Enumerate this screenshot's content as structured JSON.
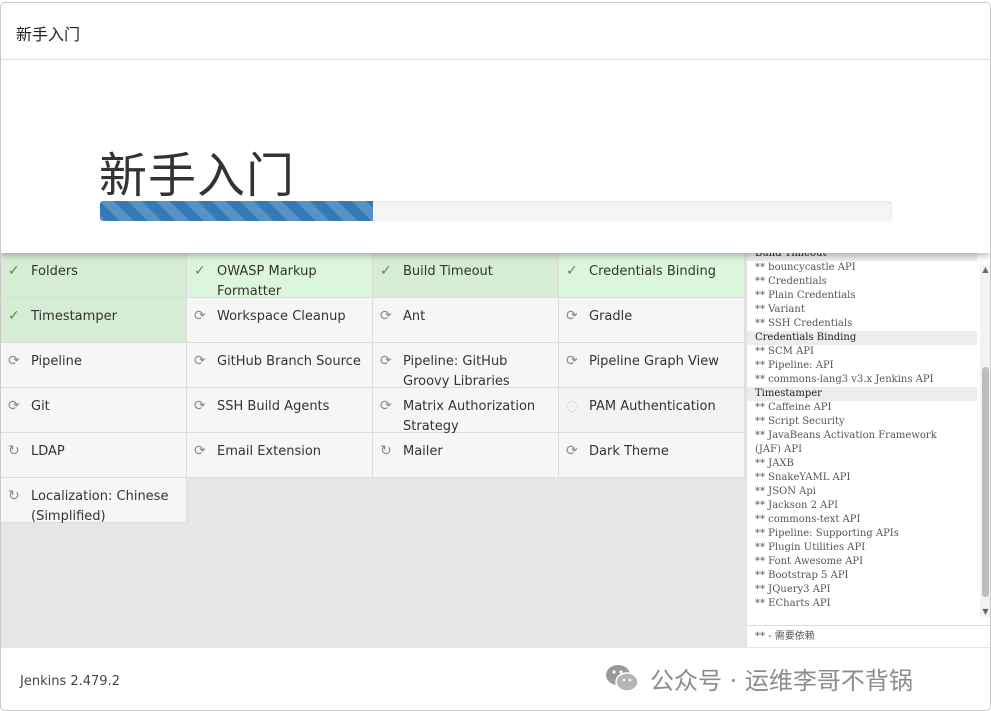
{
  "window": {
    "title": "新手入门"
  },
  "header": {
    "heading": "新手入门",
    "progress": 0.345
  },
  "plugins": [
    {
      "name": "Folders",
      "status": "success",
      "icon": "check-icon"
    },
    {
      "name": "OWASP Markup Formatter",
      "status": "active",
      "icon": "check-icon"
    },
    {
      "name": "Build Timeout",
      "status": "success",
      "icon": "check-icon"
    },
    {
      "name": "Credentials Binding",
      "status": "active",
      "icon": "check-icon"
    },
    {
      "name": "Timestamper",
      "status": "success",
      "icon": "check-icon"
    },
    {
      "name": "Workspace Cleanup",
      "status": "pending",
      "icon": "refresh-icon"
    },
    {
      "name": "Ant",
      "status": "pending",
      "icon": "refresh-icon"
    },
    {
      "name": "Gradle",
      "status": "pending",
      "icon": "refresh-icon"
    },
    {
      "name": "Pipeline",
      "status": "pending",
      "icon": "refresh-icon"
    },
    {
      "name": "GitHub Branch Source",
      "status": "pending",
      "icon": "refresh-icon"
    },
    {
      "name": "Pipeline: GitHub Groovy Libraries",
      "status": "pending",
      "icon": "refresh-icon"
    },
    {
      "name": "Pipeline Graph View",
      "status": "pending",
      "icon": "refresh-icon"
    },
    {
      "name": "Git",
      "status": "pending",
      "icon": "refresh-icon"
    },
    {
      "name": "SSH Build Agents",
      "status": "pending",
      "icon": "refresh-icon"
    },
    {
      "name": "Matrix Authorization Strategy",
      "status": "pending",
      "icon": "refresh-icon"
    },
    {
      "name": "PAM Authentication",
      "status": "idle",
      "icon": "spinner-icon"
    },
    {
      "name": "LDAP",
      "status": "pending",
      "icon": "retry-icon"
    },
    {
      "name": "Email Extension",
      "status": "pending",
      "icon": "refresh-icon"
    },
    {
      "name": "Mailer",
      "status": "pending",
      "icon": "retry-icon"
    },
    {
      "name": "Dark Theme",
      "status": "pending",
      "icon": "refresh-icon"
    },
    {
      "name": "Localization: Chinese (Simplified)",
      "status": "pending",
      "icon": "retry-icon"
    }
  ],
  "log": {
    "lines": [
      {
        "text": "Build Timeout",
        "header": true
      },
      {
        "text": "** bouncycastle API",
        "header": false
      },
      {
        "text": "** Credentials",
        "header": false
      },
      {
        "text": "** Plain Credentials",
        "header": false
      },
      {
        "text": "** Variant",
        "header": false
      },
      {
        "text": "** SSH Credentials",
        "header": false
      },
      {
        "text": "Credentials Binding",
        "header": true
      },
      {
        "text": "** SCM API",
        "header": false
      },
      {
        "text": "** Pipeline: API",
        "header": false
      },
      {
        "text": "** commons-lang3 v3.x Jenkins API",
        "header": false
      },
      {
        "text": "Timestamper",
        "header": true
      },
      {
        "text": "** Caffeine API",
        "header": false
      },
      {
        "text": "** Script Security",
        "header": false
      },
      {
        "text": "** JavaBeans Activation Framework",
        "header": false
      },
      {
        "text": "(JAF) API",
        "header": false
      },
      {
        "text": "** JAXB",
        "header": false
      },
      {
        "text": "** SnakeYAML API",
        "header": false
      },
      {
        "text": "** JSON Api",
        "header": false
      },
      {
        "text": "** Jackson 2 API",
        "header": false
      },
      {
        "text": "** commons-text API",
        "header": false
      },
      {
        "text": "** Pipeline: Supporting APIs",
        "header": false
      },
      {
        "text": "** Plugin Utilities API",
        "header": false
      },
      {
        "text": "** Font Awesome API",
        "header": false
      },
      {
        "text": "** Bootstrap 5 API",
        "header": false
      },
      {
        "text": "** JQuery3 API",
        "header": false
      },
      {
        "text": "** ECharts API",
        "header": false
      }
    ],
    "dependency_note": "** - 需要依赖"
  },
  "footer": {
    "version": "Jenkins 2.479.2",
    "watermark": "公众号 · 运维李哥不背锅"
  }
}
